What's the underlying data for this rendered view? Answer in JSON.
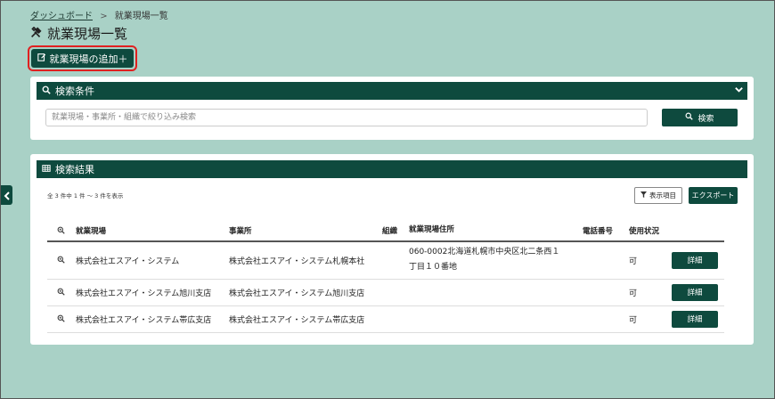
{
  "breadcrumb": {
    "home": "ダッシュボード",
    "separator": ">",
    "current": "就業現場一覧"
  },
  "page": {
    "title": "就業現場一覧",
    "title_icon": "tools-icon"
  },
  "toolbar": {
    "add_label": "就業現場の追加＋"
  },
  "search_panel": {
    "title": "検索条件",
    "placeholder": "就業現場・事業所・組織で絞り込み検索",
    "value": "",
    "search_button": "検索"
  },
  "results_panel": {
    "title": "検索結果",
    "count_text": "全 3 件中 1 件 ～ 3 件を表示",
    "columns_button": "表示項目",
    "export_button": "エクスポート"
  },
  "table": {
    "headers": {
      "site": "就業現場",
      "office": "事業所",
      "org": "組織",
      "address": "就業現場住所",
      "tel": "電話番号",
      "status": "使用状況"
    },
    "rows": [
      {
        "site": "株式会社エスアイ・システム",
        "office": "株式会社エスアイ・システム札幌本社",
        "org": "",
        "address_line1": "060-0002北海道札幌市中央区北二条西１",
        "address_line2": "丁目１０番地",
        "tel": "",
        "status": "可",
        "detail": "詳細"
      },
      {
        "site": "株式会社エスアイ・システム旭川支店",
        "office": "株式会社エスアイ・システム旭川支店",
        "org": "",
        "address_line1": "",
        "address_line2": "",
        "tel": "",
        "status": "可",
        "detail": "詳細"
      },
      {
        "site": "株式会社エスアイ・システム帯広支店",
        "office": "株式会社エスアイ・システム帯広支店",
        "org": "",
        "address_line1": "",
        "address_line2": "",
        "tel": "",
        "status": "可",
        "detail": "詳細"
      }
    ]
  },
  "colors": {
    "primary": "#0e4a3e",
    "background": "#a9d1c6",
    "highlight": "#e02020"
  }
}
